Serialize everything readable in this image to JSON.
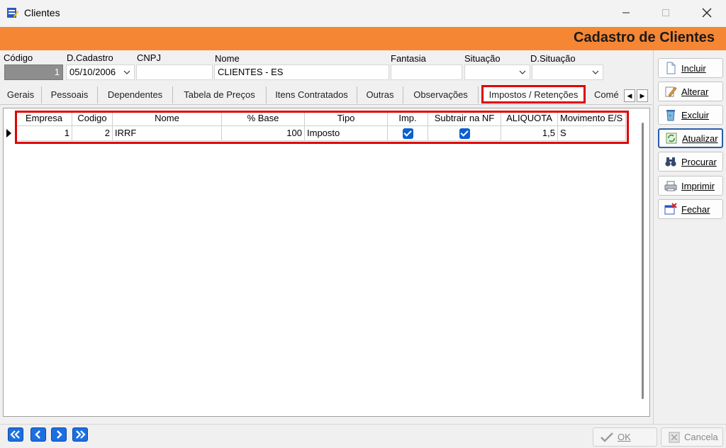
{
  "window": {
    "title": "Clientes"
  },
  "banner": {
    "title": "Cadastro de Clientes"
  },
  "form": {
    "codigo": {
      "label": "Código",
      "value": "1"
    },
    "dcadastro": {
      "label": "D.Cadastro",
      "value": "05/10/2006"
    },
    "cnpj": {
      "label": "CNPJ",
      "value": ""
    },
    "nome": {
      "label": "Nome",
      "value": "CLIENTES - ES"
    },
    "fantasia": {
      "label": "Fantasia",
      "value": ""
    },
    "situacao": {
      "label": "Situação",
      "value": ""
    },
    "dsituacao": {
      "label": "D.Situação",
      "value": ""
    }
  },
  "tabs": [
    "Gerais",
    "Pessoais",
    "Dependentes",
    "Tabela de Preços",
    "Itens Contratados",
    "Outras",
    "Observações",
    "Impostos / Retenções",
    "Comé"
  ],
  "grid": {
    "columns": [
      "Empresa",
      "Codigo",
      "Nome",
      "% Base",
      "Tipo",
      "Imp.",
      "Subtrair na NF",
      "ALIQUOTA",
      "Movimento E/S"
    ],
    "rows": [
      {
        "empresa": "1",
        "codigo": "2",
        "nome": "IRRF",
        "base": "100",
        "tipo": "Imposto",
        "imp": true,
        "subtrair": true,
        "aliquota": "1,5",
        "movimento": "S"
      }
    ]
  },
  "side_buttons": [
    "Incluir",
    "Alterar",
    "Excluir",
    "Atualizar",
    "Procurar",
    "Imprimir",
    "Fechar"
  ],
  "footer": {
    "ok": "OK",
    "cancel": "Cancela"
  },
  "colors": {
    "banner": "#f58634",
    "highlight": "#e00000",
    "nav": "#1d6fe0"
  }
}
